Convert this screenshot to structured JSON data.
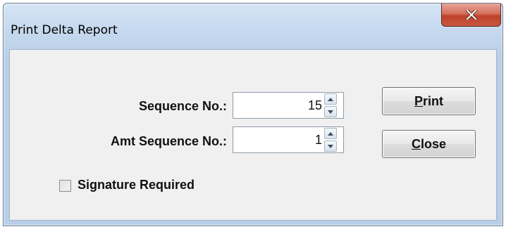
{
  "window": {
    "title": "Print Delta Report"
  },
  "form": {
    "sequence_label": "Sequence No.:",
    "sequence_value": "15",
    "amt_sequence_label": "Amt Sequence No.:",
    "amt_sequence_value": "1",
    "signature_label": "Signature Required",
    "signature_checked": false
  },
  "buttons": {
    "print": {
      "mnemonic": "P",
      "rest": "rint"
    },
    "close": {
      "mnemonic": "C",
      "rest": "lose"
    }
  },
  "icons": {
    "title_close": "close-x-icon",
    "spin_up": "arrow-up-icon",
    "spin_down": "arrow-down-icon"
  },
  "colors": {
    "close_button": "#c7503a",
    "client_area": "#f0f0f0",
    "title_bar": "#c5d8ee"
  }
}
